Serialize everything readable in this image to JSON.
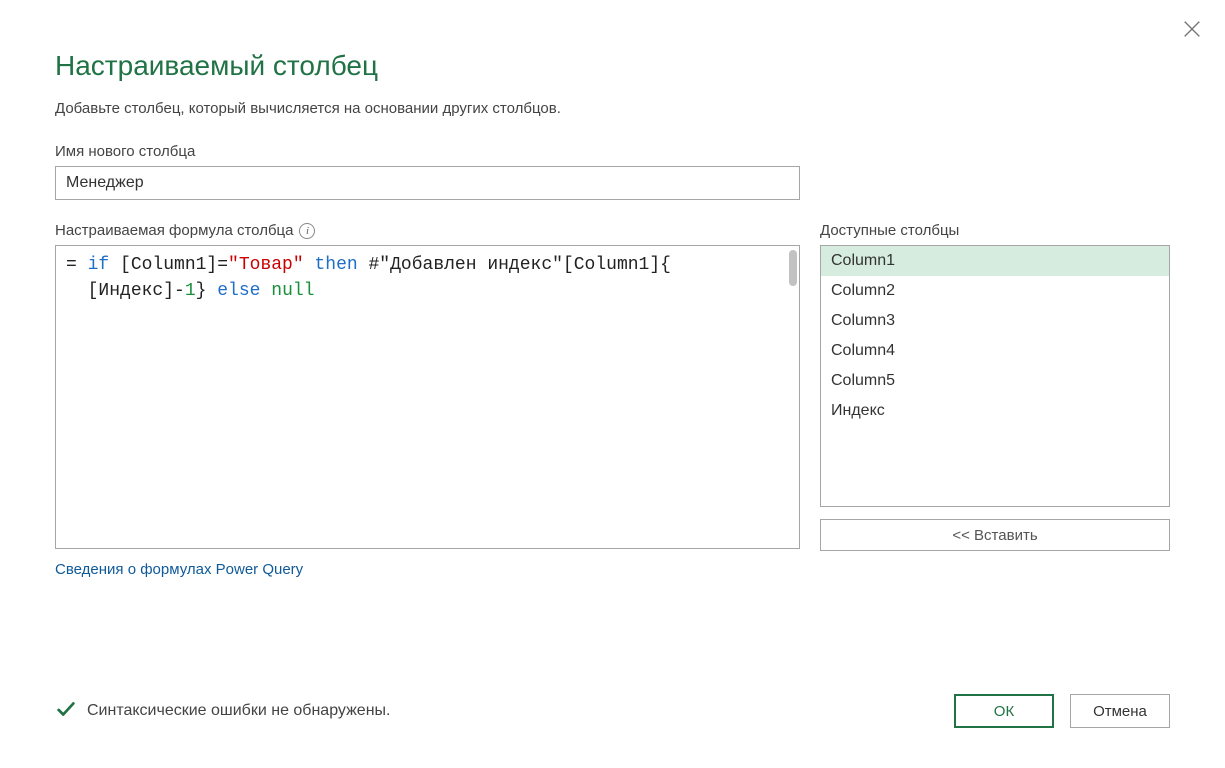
{
  "dialog": {
    "title": "Настраиваемый столбец",
    "subtitle": "Добавьте столбец, который вычисляется на основании других столбцов.",
    "name_label": "Имя нового столбца",
    "name_value": "Менеджер",
    "formula_label": "Настраиваемая формула столбца",
    "formula_plain": "= if [Column1]=\"Товар\" then #\"Добавлен индекс\"[Column1]{[Индекс]-1} else null",
    "formula_tokens": [
      {
        "cls": "tok-eq",
        "t": "= "
      },
      {
        "cls": "tok-kw",
        "t": "if"
      },
      {
        "cls": "tok-ident",
        "t": " [Column1]="
      },
      {
        "cls": "tok-str",
        "t": "\"Товар\""
      },
      {
        "cls": "tok-ident",
        "t": " "
      },
      {
        "cls": "tok-kw",
        "t": "then"
      },
      {
        "cls": "tok-ident",
        "t": " #\"Добавлен индекс\"[Column1]{\n  [Индекс]-"
      },
      {
        "cls": "tok-num",
        "t": "1"
      },
      {
        "cls": "tok-ident",
        "t": "} "
      },
      {
        "cls": "tok-kw",
        "t": "else"
      },
      {
        "cls": "tok-ident",
        "t": " "
      },
      {
        "cls": "tok-null",
        "t": "null"
      }
    ],
    "pq_link": "Сведения о формулах Power Query",
    "available_label": "Доступные столбцы",
    "available_columns": [
      "Column1",
      "Column2",
      "Column3",
      "Column4",
      "Column5",
      "Индекс"
    ],
    "selected_column_index": 0,
    "insert_label": "<< Вставить",
    "status_text": "Синтаксические ошибки не обнаружены.",
    "ok_label": "ОК",
    "cancel_label": "Отмена"
  }
}
